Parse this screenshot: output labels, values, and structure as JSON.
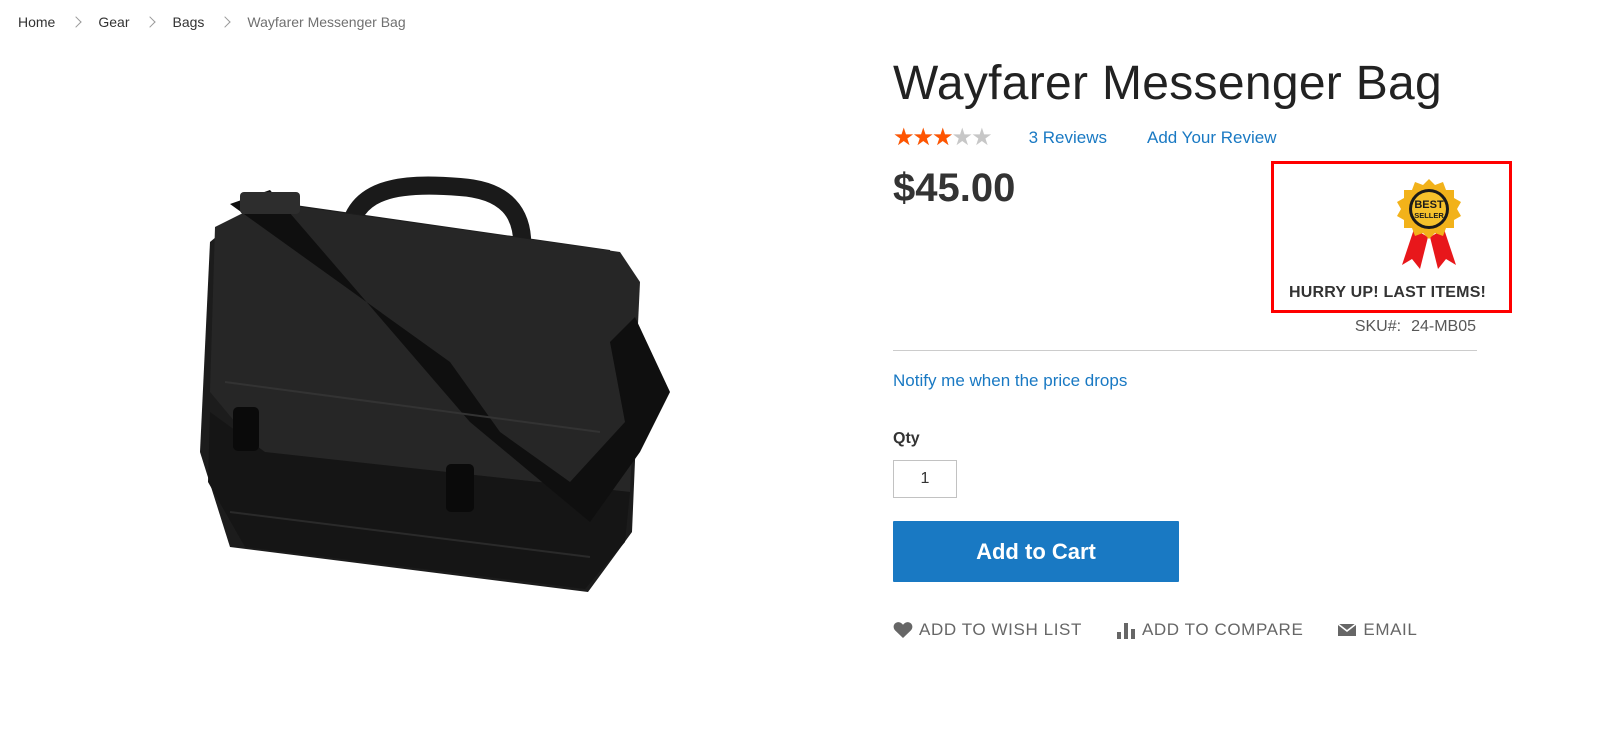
{
  "breadcrumbs": [
    {
      "label": "Home"
    },
    {
      "label": "Gear"
    },
    {
      "label": "Bags"
    },
    {
      "label": "Wayfarer Messenger Bag"
    }
  ],
  "product": {
    "title": "Wayfarer Messenger Bag",
    "rating_percent": 60,
    "reviews_label": "3 Reviews",
    "add_review_label": "Add Your Review",
    "price": "$45.00",
    "sku_label": "SKU#:",
    "sku": "24-MB05",
    "notify_label": "Notify me when the price drops",
    "image_icon": "messenger-bag-image"
  },
  "badge": {
    "icon": "best-seller-ribbon-icon",
    "emblem_text_1": "BEST",
    "emblem_text_2": "SELLER",
    "text": "HURRY UP! LAST ITEMS!",
    "border_color": "#ff0000"
  },
  "cart": {
    "qty_label": "Qty",
    "qty_value": "1",
    "add_to_cart_label": "Add to Cart"
  },
  "actions": {
    "wishlist_label": "ADD TO WISH LIST",
    "compare_label": "ADD TO COMPARE",
    "email_label": "EMAIL"
  },
  "colors": {
    "accent": "#1979c3",
    "star": "#ff5501",
    "star_empty": "#c7c7c7"
  }
}
